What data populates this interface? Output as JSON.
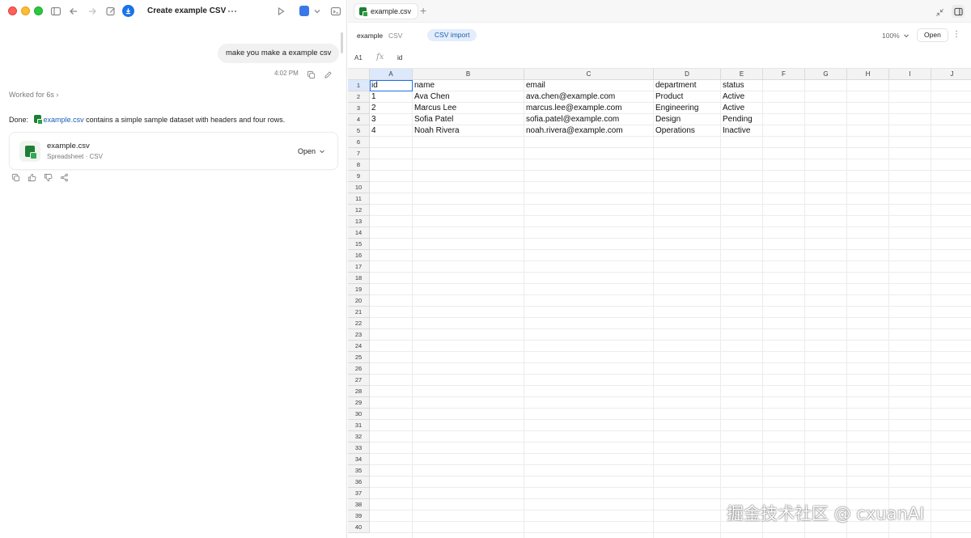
{
  "window": {
    "title": "Create example CSV"
  },
  "chat": {
    "user_message": "make you make a example csv",
    "message_time": "4:02 PM",
    "worked_label": "Worked for 6s",
    "done_prefix": "Done:",
    "done_file": "example.csv",
    "done_suffix": "contains a simple sample dataset with headers and four rows.",
    "file_card": {
      "name": "example.csv",
      "meta": "Spreadsheet · CSV",
      "open_label": "Open"
    }
  },
  "editor": {
    "tab_label": "example.csv",
    "doc_name": "example",
    "doc_type": "CSV",
    "badge": "CSV import",
    "zoom": "100%",
    "open_label": "Open",
    "cell_ref": "A1",
    "fx_symbol": "fx",
    "formula_value": "id"
  },
  "sheet": {
    "columns": [
      "A",
      "B",
      "C",
      "D",
      "E",
      "F",
      "G",
      "H",
      "I",
      "J"
    ],
    "rows": [
      [
        "id",
        "name",
        "email",
        "department",
        "status"
      ],
      [
        "1",
        "Ava Chen",
        "ava.chen@example.com",
        "Product",
        "Active"
      ],
      [
        "2",
        "Marcus Lee",
        "marcus.lee@example.com",
        "Engineering",
        "Active"
      ],
      [
        "3",
        "Sofia Patel",
        "sofia.patel@example.com",
        "Design",
        "Pending"
      ],
      [
        "4",
        "Noah Rivera",
        "noah.rivera@example.com",
        "Operations",
        "Inactive"
      ]
    ],
    "row_count": 40,
    "selected_cell": "A1"
  },
  "watermark": "掘金技术社区 @ cxuanAI",
  "colors": {
    "accent": "#1a73e8",
    "badge_bg": "#e3edfb",
    "sheet_green": "#1e7e34"
  }
}
